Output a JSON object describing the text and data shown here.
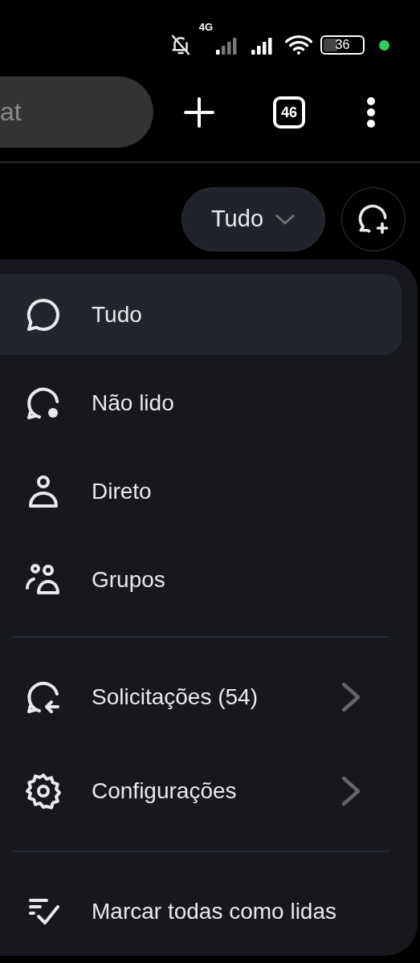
{
  "status_bar": {
    "network": "4G",
    "battery": "36"
  },
  "toolbar": {
    "address_field": {
      "placeholder": "at"
    },
    "tab_count": "46"
  },
  "filter": {
    "label": "Tudo"
  },
  "menu": [
    [
      {
        "label": "Tudo",
        "selected": true
      },
      {
        "label": "Não lido",
        "selected": false
      },
      {
        "label": "Direto",
        "selected": false
      },
      {
        "label": "Grupos",
        "selected": false
      }
    ],
    [
      {
        "label": "Solicitações (54)",
        "selected": false,
        "submenu": true
      },
      {
        "label": "Configurações",
        "selected": false,
        "submenu": true
      }
    ],
    [
      {
        "label": "Marcar todas como lidas",
        "selected": false,
        "submenu": false
      }
    ]
  ]
}
